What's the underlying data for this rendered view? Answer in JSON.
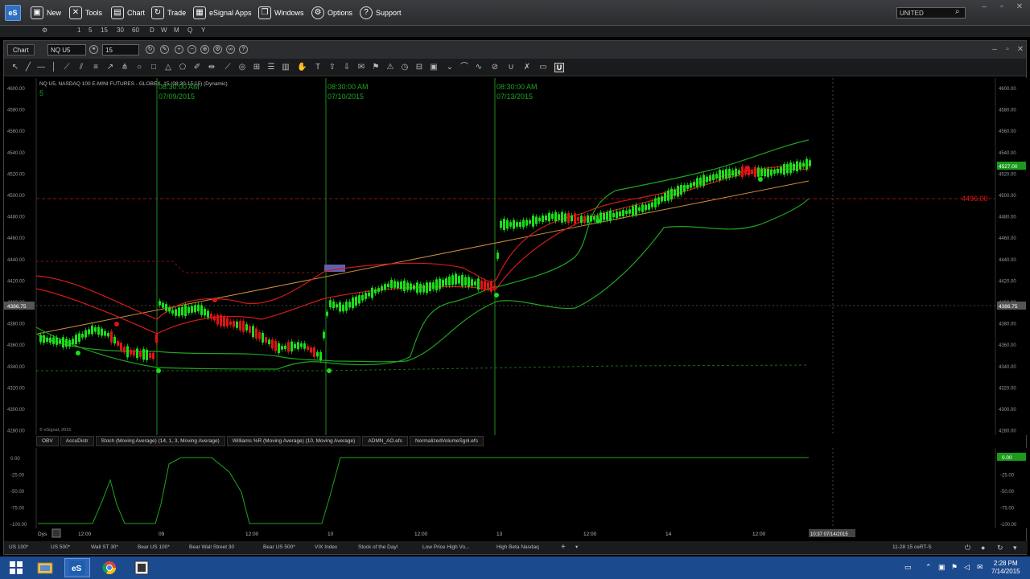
{
  "menubar": {
    "logo": "eS",
    "items": [
      {
        "label": "New",
        "icon": "new-icon"
      },
      {
        "label": "Tools",
        "icon": "tools-icon"
      },
      {
        "label": "Chart",
        "icon": "chart-icon"
      },
      {
        "label": "Trade",
        "icon": "trade-icon"
      },
      {
        "label": "eSignal Apps",
        "icon": "apps-icon"
      },
      {
        "label": "Windows",
        "icon": "windows-icon"
      },
      {
        "label": "Options",
        "icon": "options-icon"
      },
      {
        "label": "Support",
        "icon": "support-icon"
      }
    ],
    "search_value": "UNITED"
  },
  "intervals": [
    "1",
    "5",
    "15",
    "30",
    "60",
    "D",
    "W",
    "M",
    "Q",
    "Y"
  ],
  "chart_window": {
    "tab_label": "Chart",
    "symbol_value": "NQ U5",
    "interval_value": "15"
  },
  "price_pane": {
    "header": "NQ U5, NASDAQ 100 E-MINI FUTURES - GLOBEX, 15 (08:30-15:15) (Dynamic)",
    "session_markers": [
      {
        "time": "08:30:00 AM",
        "date": "07/09/2015"
      },
      {
        "time": "08:30:00 AM",
        "date": "07/10/2015"
      },
      {
        "time": "08:30:00 AM",
        "date": "07/13/2015"
      }
    ],
    "axis_ticks": [
      "4600.00",
      "4580.00",
      "4560.00",
      "4540.00",
      "4520.00",
      "4500.00",
      "4480.00",
      "4460.00",
      "4440.00",
      "4420.00",
      "4400.00",
      "4380.00",
      "4360.00",
      "4340.00",
      "4320.00",
      "4300.00",
      "4280.00"
    ],
    "last_price_label": "4527.00",
    "crosshair_label": "4386.75",
    "alert_label": "4496.00",
    "copyright": "© eSignal, 2015"
  },
  "indicator_tabs": [
    "OBV",
    "AccuDistr",
    "Stoch (Moving Average) (14, 1, 3, Moving Average)",
    "Williams %R (Moving Average) (10, Moving Average)",
    "ADMN_AO.efs",
    "NormalizedVolumeSgnl.efs"
  ],
  "osc_pane": {
    "axis_ticks": [
      "0.00",
      "-25.00",
      "-50.00",
      "-75.00",
      "-100.00"
    ],
    "last_value_label": "0.00"
  },
  "time_axis": {
    "label": "Dys",
    "ticks": [
      "12:00",
      "09",
      "12:00",
      "10",
      "12:00",
      "13",
      "12:00",
      "14",
      "12:00"
    ],
    "cursor_label": "10:37 07/14/2015"
  },
  "symbol_tabs": [
    "US 100*",
    "US 500*",
    "Wall ST 30*",
    "Bear US 100*",
    "Bear Wall Street 30",
    "Bear US 500*",
    "VIX Index",
    "Stock of the Day!",
    "Low Price High Vo...",
    "High Beta Nasdaq"
  ],
  "taskbar": {
    "status": "11-28 15 ceRT-S",
    "time": "2:28 PM",
    "date": "7/14/2015"
  },
  "colors": {
    "up_bar": "#19e019",
    "down_bar": "#e01414",
    "green_line": "#1fa31f",
    "red_line": "#d11a1a",
    "trendline": "#c98a3a",
    "session_line": "#1e8a1e",
    "taskbar": "#1b4a8e"
  }
}
